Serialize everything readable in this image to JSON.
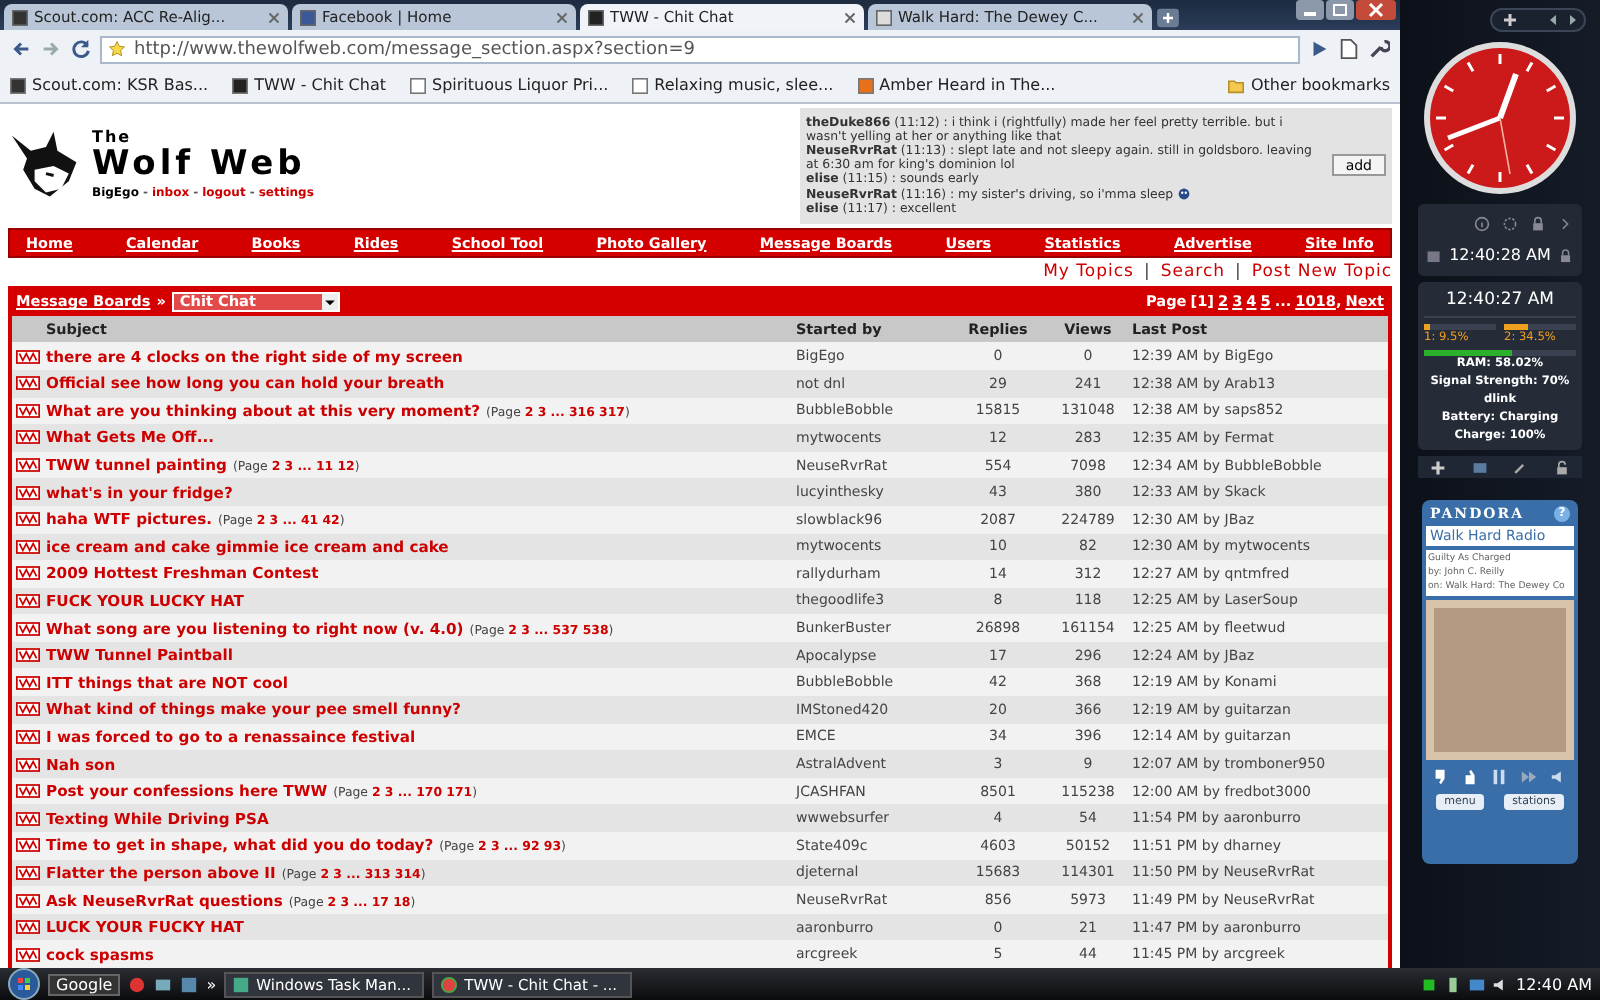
{
  "browser": {
    "tabs": [
      {
        "title": "Scout.com: ACC Re-Alig...",
        "kind": "scout",
        "selected": false
      },
      {
        "title": "Facebook | Home",
        "kind": "facebook",
        "selected": false
      },
      {
        "title": "TWW - Chit Chat",
        "kind": "wolf",
        "selected": true
      },
      {
        "title": "Walk Hard: The Dewey C...",
        "kind": "wiki",
        "selected": false
      }
    ],
    "url": "http://www.thewolfweb.com/message_section.aspx?section=9",
    "bookmarks": [
      {
        "title": "Scout.com: KSR Bas...",
        "kind": "scout"
      },
      {
        "title": "TWW - Chit Chat",
        "kind": "wolf"
      },
      {
        "title": "Spirituous Liquor Pri...",
        "kind": "page"
      },
      {
        "title": "Relaxing music, slee...",
        "kind": "page"
      },
      {
        "title": "Amber Heard in The...",
        "kind": "fox"
      }
    ],
    "other_bookmarks": "Other bookmarks"
  },
  "site": {
    "logo_small": "The",
    "logo_big": "Wolf Web",
    "user_links": [
      "BigEgo",
      "inbox",
      "logout",
      "settings"
    ],
    "separator": "-",
    "shoutbox": [
      {
        "text": "**theDuke866** (11:12) : i think i (rightfully) made her feel pretty terrible. but i wasn't yelling at her or anything like that",
        "emoticon": false
      },
      {
        "text": "**NeuseRvrRat** (11:13) : slept late and not sleepy again. still in goldsboro. leaving at 6:30 am for king's dominion lol",
        "emoticon": false
      },
      {
        "text": "**elise** (11:15) : sounds early",
        "emoticon": false
      },
      {
        "text": "**NeuseRvrRat** (11:16) : my sister's driving, so i'mma sleep",
        "emoticon": true
      },
      {
        "text": "**elise** (11:17) : excellent",
        "emoticon": false
      }
    ],
    "add_button": "add",
    "nav": [
      "Home",
      "Calendar",
      "Books",
      "Rides",
      "School Tool",
      "Photo Gallery",
      "Message Boards",
      "Users",
      "Statistics",
      "Advertise",
      "Site Info"
    ],
    "actions": [
      "My Topics",
      "Search",
      "Post New Topic"
    ],
    "action_separator": "|"
  },
  "forum": {
    "breadcrumb": "Message Boards",
    "crumb_separator": "»",
    "board": "Chit Chat",
    "pagination": {
      "label": "Page",
      "current": "[1]",
      "pages": [
        "2",
        "3",
        "4",
        "5"
      ],
      "ellipsis": "...",
      "last": "1018",
      "comma": ",",
      "next": "Next"
    },
    "columns": [
      "Subject",
      "Started by",
      "Replies",
      "Views",
      "Last Post"
    ],
    "rows": [
      {
        "subject": "there are 4 clocks on the right side of my screen",
        "started_by": "BigEgo",
        "replies": "0",
        "views": "0",
        "last_post": "12:39 AM by BigEgo"
      },
      {
        "subject": "Official see how long you can hold your breath",
        "started_by": "not dnl",
        "replies": "29",
        "views": "241",
        "last_post": "12:38 AM by Arab13"
      },
      {
        "subject": "What are you thinking about at this very moment?",
        "pager": "(Page **2 3 ... 316 317**)",
        "started_by": "BubbleBobble",
        "replies": "15815",
        "views": "131048",
        "last_post": "12:38 AM by saps852"
      },
      {
        "subject": "What Gets Me Off...",
        "started_by": "mytwocents",
        "replies": "12",
        "views": "283",
        "last_post": "12:35 AM by Fermat"
      },
      {
        "subject": "TWW tunnel painting",
        "pager": "(Page **2 3 ... 11 12**)",
        "started_by": "NeuseRvrRat",
        "replies": "554",
        "views": "7098",
        "last_post": "12:34 AM by BubbleBobble"
      },
      {
        "subject": "what's in your fridge?",
        "started_by": "lucyinthesky",
        "replies": "43",
        "views": "380",
        "last_post": "12:33 AM by Skack"
      },
      {
        "subject": "haha WTF pictures.",
        "pager": "(Page **2 3 ... 41 42**)",
        "started_by": "slowblack96",
        "replies": "2087",
        "views": "224789",
        "last_post": "12:30 AM by JBaz"
      },
      {
        "subject": "ice cream and cake gimmie ice cream and cake",
        "started_by": "mytwocents",
        "replies": "10",
        "views": "82",
        "last_post": "12:30 AM by mytwocents"
      },
      {
        "subject": "2009 Hottest Freshman Contest",
        "started_by": "rallydurham",
        "replies": "14",
        "views": "312",
        "last_post": "12:27 AM by qntmfred"
      },
      {
        "subject": "FUCK YOUR LUCKY HAT",
        "started_by": "thegoodlife3",
        "replies": "8",
        "views": "118",
        "last_post": "12:25 AM by LaserSoup"
      },
      {
        "subject": "What song are you listening to right now (v. 4.0)",
        "pager": "(Page **2 3 ... 537 538**)",
        "started_by": "BunkerBuster",
        "replies": "26898",
        "views": "161154",
        "last_post": "12:25 AM by fleetwud"
      },
      {
        "subject": "TWW Tunnel Paintball",
        "started_by": "Apocalypse",
        "replies": "17",
        "views": "296",
        "last_post": "12:24 AM by JBaz"
      },
      {
        "subject": "ITT things that are NOT cool",
        "started_by": "BubbleBobble",
        "replies": "42",
        "views": "368",
        "last_post": "12:19 AM by Konami"
      },
      {
        "subject": "What kind of things make your pee smell funny?",
        "started_by": "IMStoned420",
        "replies": "20",
        "views": "366",
        "last_post": "12:19 AM by guitarzan"
      },
      {
        "subject": "I was forced to go to a renassaince festival",
        "started_by": "EMCE",
        "replies": "34",
        "views": "396",
        "last_post": "12:14 AM by guitarzan"
      },
      {
        "subject": "Nah son",
        "started_by": "AstralAdvent",
        "replies": "3",
        "views": "9",
        "last_post": "12:07 AM by tromboner950"
      },
      {
        "subject": "Post your confessions here TWW",
        "pager": "(Page **2 3 ... 170 171**)",
        "started_by": "JCASHFAN",
        "replies": "8501",
        "views": "115238",
        "last_post": "12:00 AM by fredbot3000"
      },
      {
        "subject": "Texting While Driving PSA",
        "started_by": "wwwebsurfer",
        "replies": "4",
        "views": "54",
        "last_post": "11:54 PM by aaronburro"
      },
      {
        "subject": "Time to get in shape, what did you do today?",
        "pager": "(Page **2 3 ... 92 93**)",
        "started_by": "State409c",
        "replies": "4603",
        "views": "50152",
        "last_post": "11:51 PM by dharney"
      },
      {
        "subject": "Flatter the person above II",
        "pager": "(Page **2 3 ... 313 314**)",
        "started_by": "djeternal",
        "replies": "15683",
        "views": "114301",
        "last_post": "11:50 PM by NeuseRvrRat"
      },
      {
        "subject": "Ask NeuseRvrRat questions",
        "pager": "(Page **2 3 ... 17 18**)",
        "started_by": "NeuseRvrRat",
        "replies": "856",
        "views": "5973",
        "last_post": "11:49 PM by NeuseRvrRat"
      },
      {
        "subject": "LUCK YOUR FUCKY HAT",
        "started_by": "aaronburro",
        "replies": "0",
        "views": "21",
        "last_post": "11:47 PM by aaronburro"
      },
      {
        "subject": "cock spasms",
        "started_by": "arcgreek",
        "replies": "5",
        "views": "44",
        "last_post": "11:45 PM by arcgreek"
      }
    ]
  },
  "gadgets": {
    "clock_time": "12:40:28 AM",
    "monitor": {
      "time": "12:40:27 AM",
      "cpus": [
        {
          "label": "1: 9.5%",
          "level": 0.095
        },
        {
          "label": "2: 34.5%",
          "level": 0.345
        }
      ],
      "ram": {
        "label": "RAM: 58.02%",
        "level": 0.58
      },
      "lines": [
        "Signal Strength: 70%",
        "dlink",
        "Battery: Charging",
        "Charge: 100%"
      ]
    },
    "pandora": {
      "brand": "PANDORA",
      "help": "?",
      "station": "Walk Hard Radio",
      "song": "Guilty As Charged",
      "artist": "by: John C. Reilly",
      "album": "on: Walk Hard: The Dewey Co",
      "buttons": [
        "menu",
        "stations"
      ]
    }
  },
  "taskbar": {
    "search": "Google",
    "more": "»",
    "tasks": [
      {
        "title": "Windows Task Man...",
        "kind": "taskmgr"
      },
      {
        "title": "TWW - Chit Chat - ...",
        "kind": "chrome"
      }
    ],
    "time": "12:40 AM"
  }
}
